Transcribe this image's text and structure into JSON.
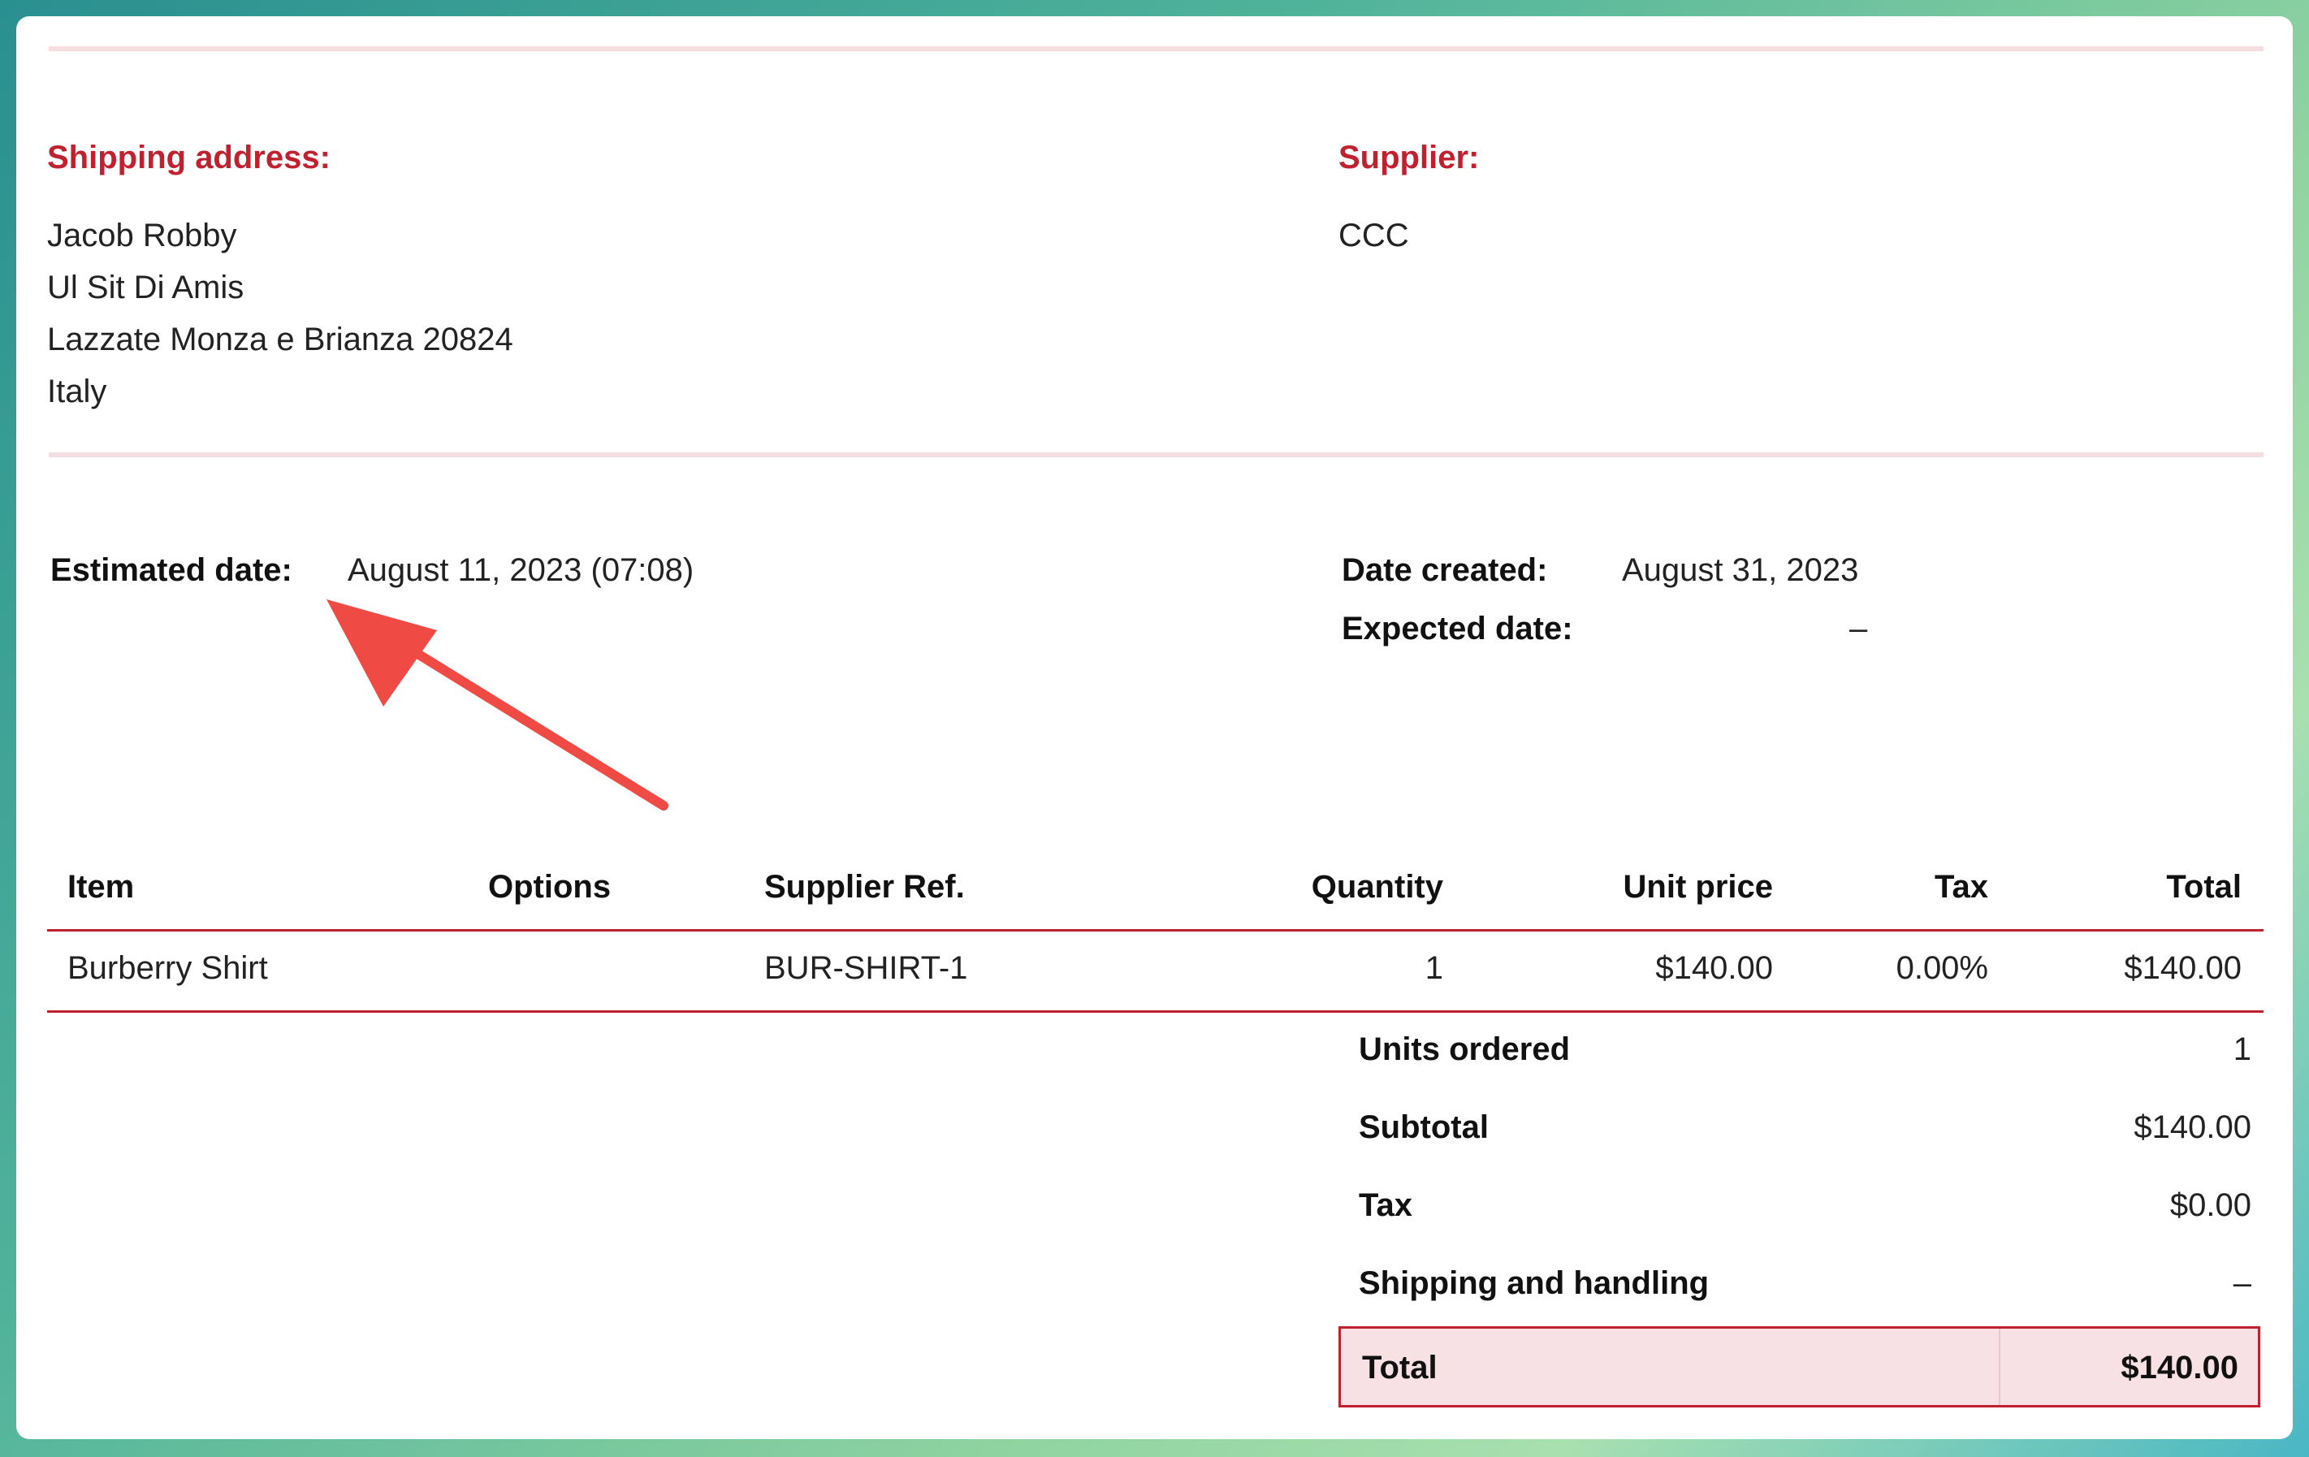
{
  "shipping": {
    "label": "Shipping address:",
    "name": "Jacob Robby",
    "street": "Ul Sit Di Amis",
    "city": "Lazzate Monza e Brianza 20824",
    "country": "Italy"
  },
  "supplier": {
    "label": "Supplier:",
    "name": "CCC"
  },
  "dates": {
    "estimated_label": "Estimated date:",
    "estimated_value": "August 11, 2023 (07:08)",
    "created_label": "Date created:",
    "created_value": "August 31, 2023",
    "expected_label": "Expected date:",
    "expected_value": "–"
  },
  "table": {
    "headers": {
      "item": "Item",
      "options": "Options",
      "supplier_ref": "Supplier Ref.",
      "quantity": "Quantity",
      "unit_price": "Unit price",
      "tax": "Tax",
      "total": "Total"
    },
    "rows": [
      {
        "item": "Burberry Shirt",
        "options": "",
        "supplier_ref": "BUR-SHIRT-1",
        "quantity": "1",
        "unit_price": "$140.00",
        "tax": "0.00%",
        "total": "$140.00"
      }
    ]
  },
  "summary": {
    "units_ordered_label": "Units ordered",
    "units_ordered_value": "1",
    "subtotal_label": "Subtotal",
    "subtotal_value": "$140.00",
    "tax_label": "Tax",
    "tax_value": "$0.00",
    "shipping_label": "Shipping and handling",
    "shipping_value": "–",
    "total_label": "Total",
    "total_value": "$140.00"
  },
  "annotation": {
    "arrow_color": "#ef4a43",
    "icon": "arrow-annotation-icon"
  },
  "colors": {
    "accent": "#c0212f",
    "total_bg": "#f7e1e4",
    "rule": "#f6dde0"
  }
}
